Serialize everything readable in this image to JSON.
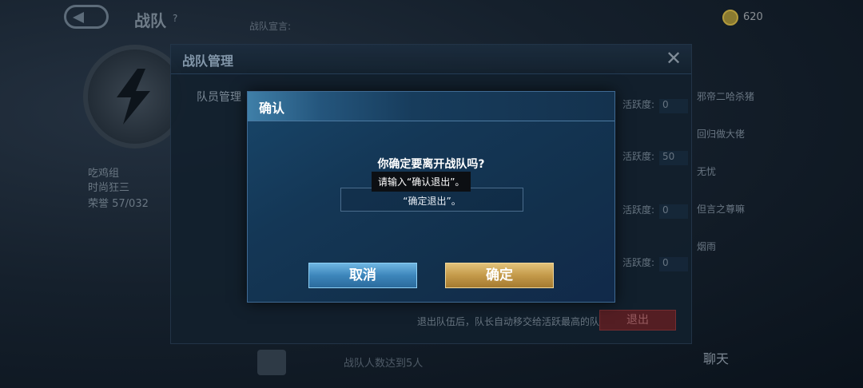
{
  "background": {
    "title": "战队",
    "title_help": "?",
    "motto": "战队宣言:",
    "currency": "620",
    "team_name": "吃鸡组",
    "team_sub": "时尚狂三",
    "rank": "荣誉 57/032",
    "chat": "聊天",
    "bottom_text": "战队人数达到5人",
    "members": [
      "邪帝二哈杀猪",
      "回归做大佬",
      "无忧",
      "但言之尊嘛",
      "烟雨"
    ]
  },
  "panel": {
    "title": "战队管理",
    "close": "✕",
    "tab_member": "队员管理",
    "activity_label": "活跃度:",
    "activity_values": [
      "0",
      "50",
      "0",
      "0"
    ],
    "hint": "退出队伍后，队长自动移交给活跃最高的队员",
    "quit": "退出"
  },
  "dialog": {
    "title": "确认",
    "question": "你确定要离开战队吗?",
    "tooltip": "请输入“确认退出”。",
    "input_value": "“确定退出”。",
    "cancel": "取消",
    "confirm": "确定"
  }
}
